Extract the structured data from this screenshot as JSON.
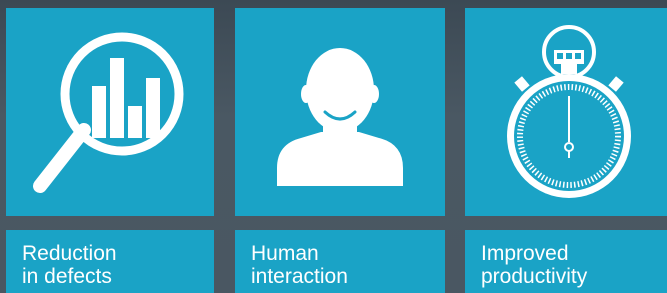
{
  "tiles": [
    {
      "icon": "magnifier-chart-icon",
      "label": {
        "line1": "Reduction",
        "line2": "in defects"
      }
    },
    {
      "icon": "person-icon",
      "label": {
        "line1": "Human",
        "line2": "interaction"
      }
    },
    {
      "icon": "stopwatch-icon",
      "label": {
        "line1": "Improved",
        "line2": "productivity"
      }
    }
  ],
  "colors": {
    "tile": "#1aa3c6",
    "background": "#44515c",
    "icon": "#ffffff"
  }
}
